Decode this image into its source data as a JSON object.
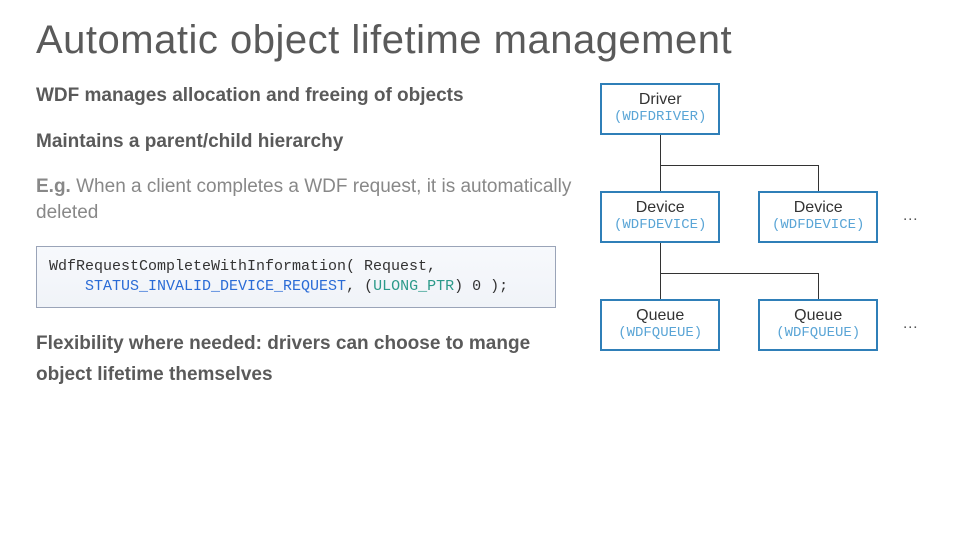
{
  "title": "Automatic object lifetime management",
  "left": {
    "bullet1": "WDF manages allocation and freeing of objects",
    "bullet2": "Maintains a parent/child hierarchy",
    "bullet3a": "E.g. ",
    "bullet3b": "When a client completes a WDF request, it is automatically deleted",
    "code": {
      "line1a": "WdfRequestCompleteWithInformation( Request,",
      "line2a": "    ",
      "line2b": "STATUS_INVALID_DEVICE_REQUEST",
      "line2c": ", (",
      "line2d": "ULONG_PTR",
      "line2e": ") 0 );"
    },
    "bullet4": "Flexibility where needed: drivers can choose to mange object lifetime themselves"
  },
  "diagram": {
    "driver": {
      "label": "Driver",
      "sub": "(WDFDRIVER)"
    },
    "device1": {
      "label": "Device",
      "sub": "(WDFDEVICE)"
    },
    "device2": {
      "label": "Device",
      "sub": "(WDFDEVICE)"
    },
    "queue1": {
      "label": "Queue",
      "sub": "(WDFQUEUE)"
    },
    "queue2": {
      "label": "Queue",
      "sub": "(WDFQUEUE)"
    },
    "ellipsis": "…"
  }
}
